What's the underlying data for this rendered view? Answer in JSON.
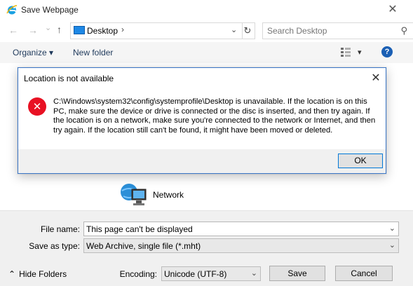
{
  "window": {
    "title": "Save Webpage",
    "close_glyph": "✕"
  },
  "nav": {
    "back_glyph": "←",
    "forward_glyph": "→",
    "recent_glyph": "⌄",
    "up_glyph": "↑",
    "address": "Desktop",
    "address_chevron": "›",
    "dropdown_glyph": "⌄",
    "refresh_glyph": "↻",
    "search_placeholder": "Search Desktop",
    "search_glyph": "⚲"
  },
  "toolbar": {
    "organize": "Organize ▾",
    "new_folder": "New folder",
    "view_caret": "▾",
    "help": "?"
  },
  "content": {
    "network_label": "Network"
  },
  "dialog": {
    "title": "Location is not available",
    "close_glyph": "✕",
    "message": "C:\\Windows\\system32\\config\\systemprofile\\Desktop is unavailable. If the location is on this PC, make sure the device or drive is connected or the disc is inserted, and then try again. If the location is on a network, make sure you're connected to the network or Internet, and then try again. If the location still can't be found, it might have been moved or deleted.",
    "ok_label": "OK",
    "error_glyph": "✕"
  },
  "form": {
    "file_name_label": "File name:",
    "file_name_value": "This page can't be displayed",
    "save_as_type_label": "Save as type:",
    "save_as_type_value": "Web Archive, single file (*.mht)",
    "encoding_label": "Encoding:",
    "encoding_value": "Unicode (UTF-8)",
    "caret": "⌄",
    "save_label": "Save",
    "cancel_label": "Cancel",
    "hide_folders_label": "Hide Folders",
    "hide_folders_glyph": "⌃"
  },
  "colors": {
    "accent": "#0078d7",
    "error_red": "#e81123",
    "help_blue": "#1a5fb4"
  }
}
